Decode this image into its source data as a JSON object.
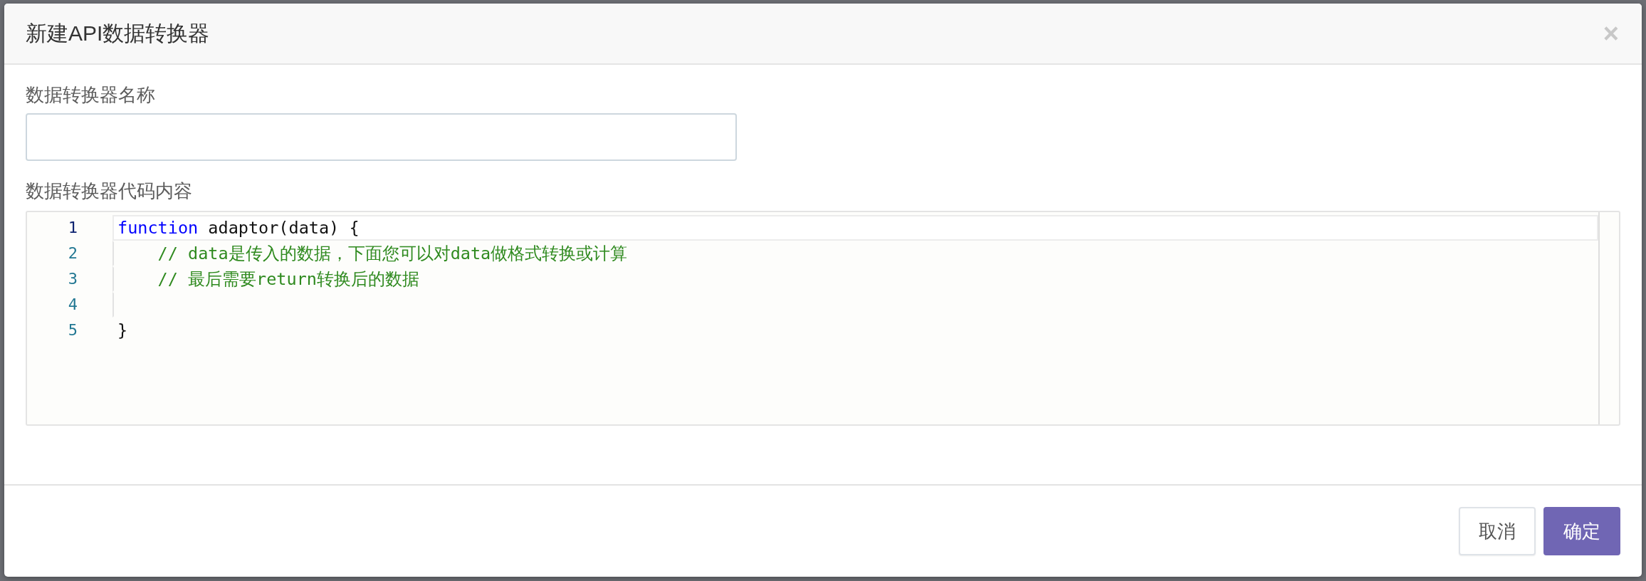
{
  "dialog": {
    "title": "新建API数据转换器",
    "close": "×"
  },
  "name_field": {
    "label": "数据转换器名称"
  },
  "code_field": {
    "label": "数据转换器代码内容",
    "lines": [
      {
        "number": "1",
        "current": true,
        "tokens": [
          {
            "kind": "keyword",
            "text": "function"
          },
          {
            "kind": "plain",
            "text": " adaptor(data) {"
          }
        ]
      },
      {
        "number": "2",
        "current": false,
        "tokens": [
          {
            "kind": "comment",
            "text": "    // data是传入的数据，下面您可以对data做格式转换或计算"
          }
        ]
      },
      {
        "number": "3",
        "current": false,
        "tokens": [
          {
            "kind": "comment",
            "text": "    // 最后需要return转换后的数据"
          }
        ]
      },
      {
        "number": "4",
        "current": false
      },
      {
        "number": "5",
        "current": false,
        "tokens": [
          {
            "kind": "plain",
            "text": "}"
          }
        ]
      }
    ]
  },
  "buttons": [
    {
      "label": "取消",
      "kind": "default"
    },
    {
      "label": "确定",
      "kind": "primary"
    }
  ]
}
